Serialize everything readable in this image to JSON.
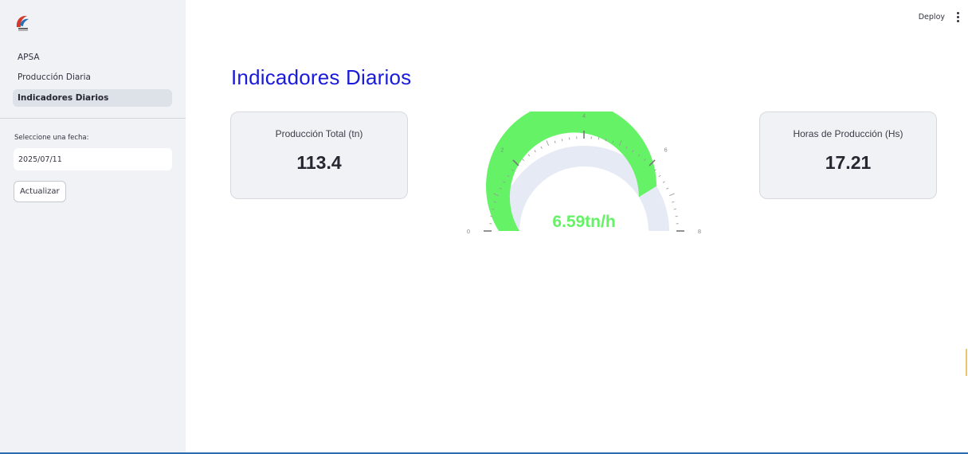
{
  "header": {
    "deploy_label": "Deploy"
  },
  "sidebar": {
    "items": [
      {
        "label": "APSA"
      },
      {
        "label": "Producción Diaria"
      },
      {
        "label": "Indicadores Diarios"
      }
    ],
    "date_label": "Seleccione una fecha:",
    "date_value": "2025/07/11",
    "update_label": "Actualizar"
  },
  "main": {
    "title": "Indicadores Diarios",
    "metric_left": {
      "title": "Producción Total (tn)",
      "value": "113.4"
    },
    "metric_right": {
      "title": "Horas de Producción (Hs)",
      "value": "17.21"
    },
    "gauge": {
      "value": 6.59,
      "display": "6.59tn/h",
      "min": 0,
      "max": 8,
      "tick_labels": [
        "0",
        "2",
        "4",
        "6",
        "8"
      ],
      "bar_color": "#66f266",
      "track_color": "#e6eaf4"
    }
  },
  "colors": {
    "title": "#1a1adb",
    "sidebar_bg": "#f0f2f6",
    "active_item": "#dde1e8"
  }
}
